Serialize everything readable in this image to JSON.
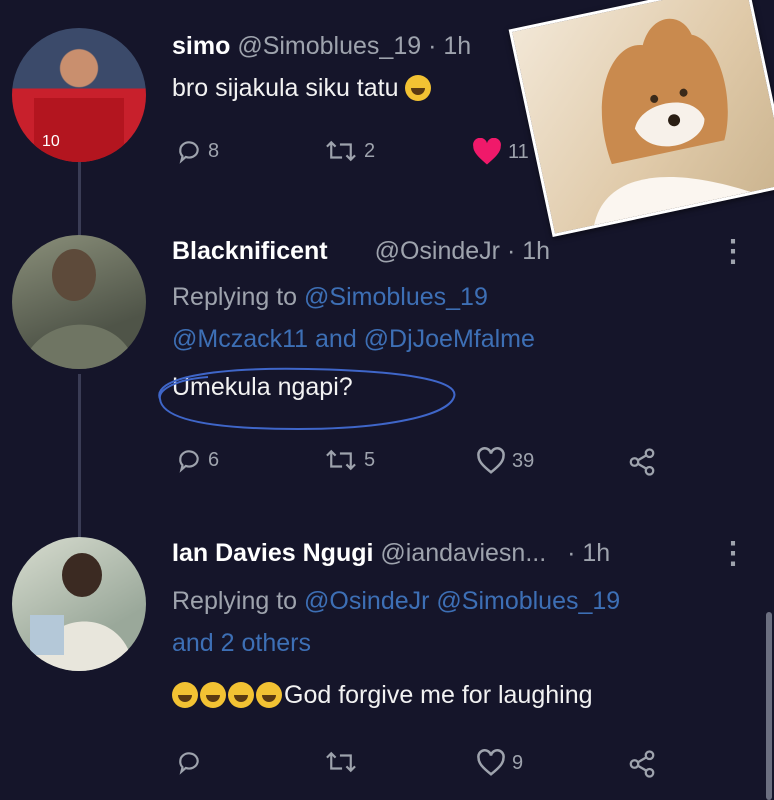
{
  "tweets": [
    {
      "name": "simo",
      "handle": "@Simoblues_19",
      "time": "· 1h",
      "text": "bro sijakula siku tatu",
      "replies": "8",
      "retweets": "2",
      "likes": "11",
      "liked": true
    },
    {
      "name": "Blacknificent",
      "handle": "@OsindeJr",
      "time": "· 1h",
      "replying_prefix": "Replying to ",
      "replying_line1": "@Simoblues_19",
      "replying_line2": "@Mczack11 and @DjJoeMfalme",
      "text": "Umekula ngapi?",
      "replies": "6",
      "retweets": "5",
      "likes": "39"
    },
    {
      "name": "Ian Davies Ngugi",
      "handle": "@iandaviesn...",
      "time": "· 1h",
      "replying_prefix": "Replying to ",
      "replying_line1": "@OsindeJr @Simoblues_19",
      "replying_line2": "and 2 others",
      "text": "God forgive me for laughing",
      "replies": "",
      "retweets": "",
      "likes": "9"
    }
  ],
  "colors": {
    "background": "#15152a",
    "mention": "#3d6fb5",
    "like_active": "#f0196a",
    "muted": "#9ea3ad",
    "annotation": "#3f66c9"
  }
}
